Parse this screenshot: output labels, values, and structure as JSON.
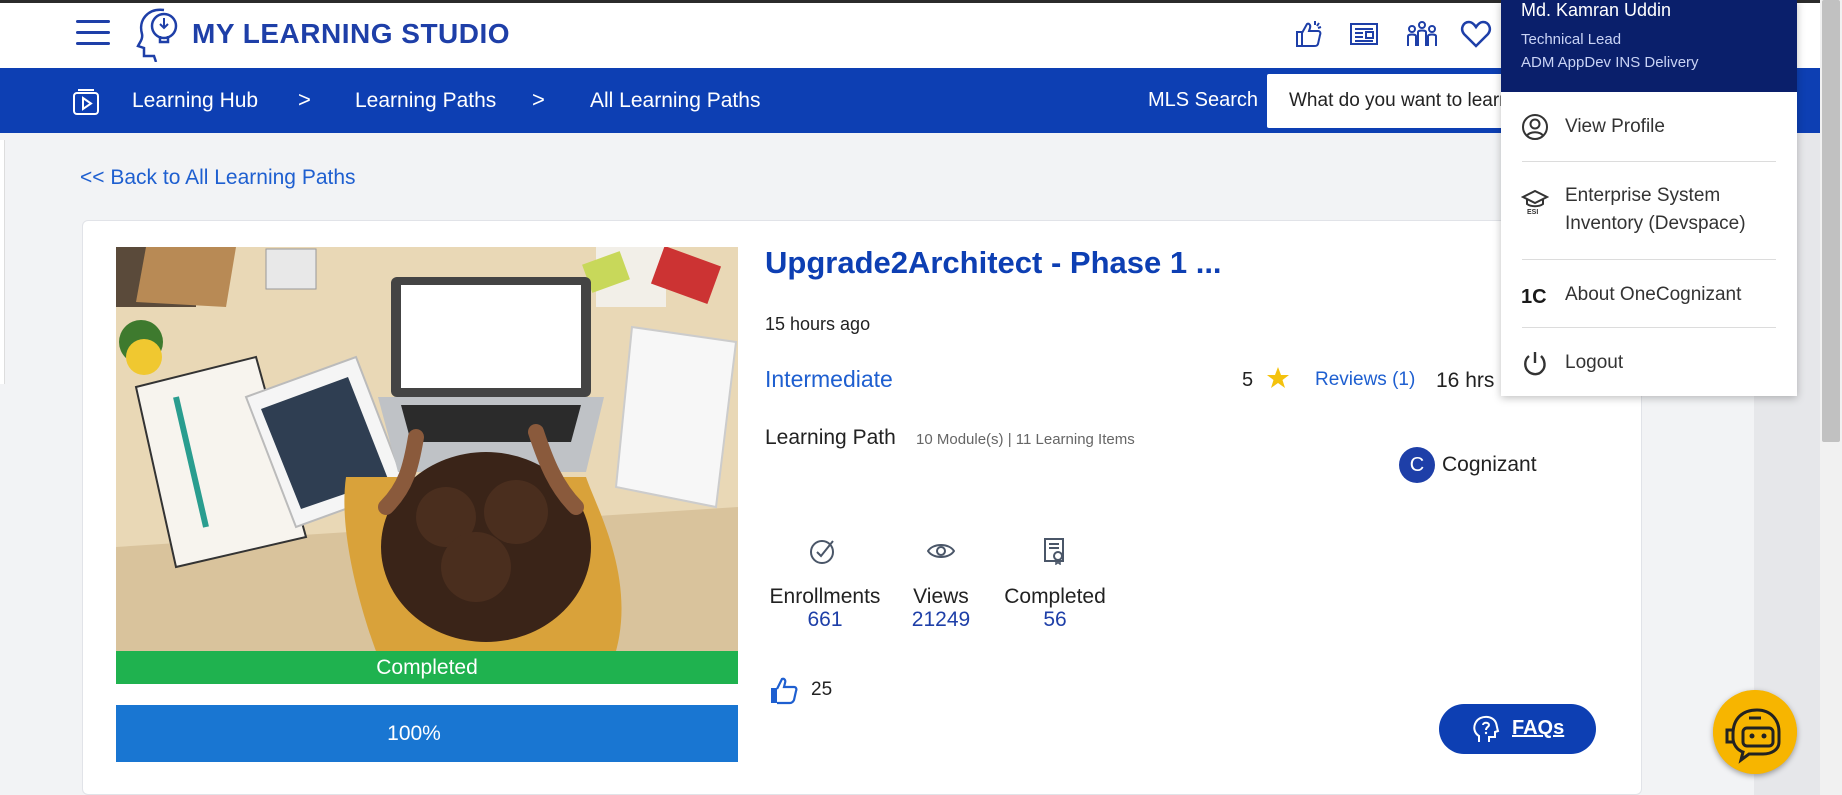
{
  "header": {
    "brand": "MY LEARNING STUDIO",
    "icons": [
      "recommend-icon",
      "news-icon",
      "community-icon",
      "favorites-icon"
    ]
  },
  "nav": {
    "items": [
      "Learning Hub",
      "Learning Paths",
      "All Learning Paths"
    ],
    "chevron": ">",
    "search_label": "MLS Search",
    "search_placeholder": "What do you want to learn?"
  },
  "page": {
    "back_link": "<< Back to All Learning Paths"
  },
  "course": {
    "title": "Upgrade2Architect - Phase 1 ...",
    "time_ago": "15 hours ago",
    "level": "Intermediate",
    "rating": "5",
    "reviews": "Reviews (1)",
    "duration": "16 hrs",
    "type": "Learning Path",
    "meta": "10 Module(s) | 11 Learning Items",
    "provider_initial": "C",
    "provider": "Cognizant",
    "status_label": "Completed",
    "progress_percent": 100,
    "progress_label": "100%",
    "likes": "25",
    "stats": [
      {
        "label": "Enrollments",
        "value": "661",
        "icon": "enrollment-icon"
      },
      {
        "label": "Views",
        "value": "21249",
        "icon": "eye-icon"
      },
      {
        "label": "Completed",
        "value": "56",
        "icon": "certificate-icon"
      }
    ]
  },
  "faq": {
    "label": "FAQs"
  },
  "profile_menu": {
    "name": "Md. Kamran Uddin",
    "role": "Technical Lead",
    "department": "ADM AppDev INS Delivery",
    "items": [
      {
        "label": "View Profile",
        "icon": "user-circle-icon"
      },
      {
        "label": "Enterprise System",
        "label2": "Inventory (Devspace)",
        "icon": "esi-icon"
      },
      {
        "label": "About OneCognizant",
        "icon": "onecognizant-icon"
      },
      {
        "label": "Logout",
        "icon": "power-icon"
      }
    ]
  },
  "colors": {
    "brand_blue": "#1e3fa8",
    "nav_blue": "#0d3fb3",
    "completed_green": "#1fb24f",
    "progress_blue": "#1976d2",
    "menu_header": "#0a1f6b",
    "bot_yellow": "#f7b500"
  }
}
